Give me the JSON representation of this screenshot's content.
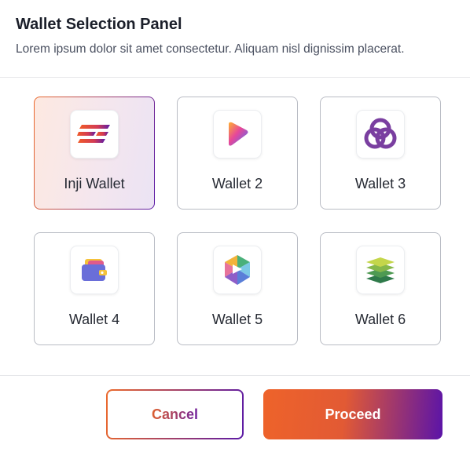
{
  "panel": {
    "title": "Wallet Selection Panel",
    "subtitle": "Lorem ipsum dolor sit amet consectetur. Aliquam nisl dignissim placerat."
  },
  "wallets": [
    {
      "label": "Inji Wallet",
      "icon": "inji-logo-icon",
      "selected": true
    },
    {
      "label": "Wallet 2",
      "icon": "play-gradient-icon",
      "selected": false
    },
    {
      "label": "Wallet 3",
      "icon": "triple-ring-icon",
      "selected": false
    },
    {
      "label": "Wallet 4",
      "icon": "wallet-cards-icon",
      "selected": false
    },
    {
      "label": "Wallet 5",
      "icon": "hexagon-arrow-icon",
      "selected": false
    },
    {
      "label": "Wallet 6",
      "icon": "stack-layers-icon",
      "selected": false
    }
  ],
  "actions": {
    "cancel_label": "Cancel",
    "proceed_label": "Proceed"
  },
  "colors": {
    "accent_orange": "#ec6a2c",
    "accent_purple": "#5b1aa6",
    "border": "#b9bcc4"
  }
}
